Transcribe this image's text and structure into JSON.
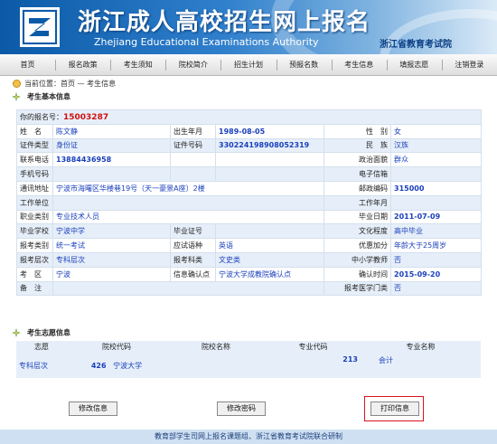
{
  "header": {
    "title": "浙江成人高校招生网上报名",
    "subtitle": "Zhejiang Educational Examinations Authority",
    "authority": "浙江省教育考试院"
  },
  "nav": [
    "首页",
    "报名政策",
    "考生须知",
    "院校简介",
    "招生计划",
    "预报名数",
    "考生信息",
    "填报志愿",
    "注销登录"
  ],
  "breadcrumb": "当前位置：首页 — 考生信息",
  "basic": {
    "section_title": "考生基本信息",
    "reg_label": "你的报名号：",
    "reg_no": "15003287",
    "name_label": "姓　名",
    "name": "陈文静",
    "birth_label": "出生年月",
    "birth": "1989-08-05",
    "gender_label": "性　别",
    "gender": "女",
    "id_type_label": "证件类型",
    "id_type": "身份证",
    "id_no_label": "证件号码",
    "id_no": "330224198908052319",
    "ethnic_label": "民　族",
    "ethnic": "汉族",
    "phone_label": "联系电话",
    "phone": "13884436958",
    "political_label": "政治面貌",
    "political": "群众",
    "mobile_label": "手机号码",
    "mobile": "",
    "email_label": "电子信箱",
    "email": "",
    "address_label": "通讯地址",
    "address": "宁波市海曙区华楼巷19号（天一豪景A座）2楼",
    "postcode_label": "邮政编码",
    "postcode": "315000",
    "employer_label": "工作单位",
    "employer": "",
    "work_years_label": "工作年月",
    "work_years": "",
    "job_label": "职业类别",
    "job": "专业技术人员",
    "grad_date_label": "毕业日期",
    "grad_date": "2011-07-09",
    "school_label": "毕业学校",
    "school": "宁波中学",
    "cert_label": "毕业证号",
    "cert": "",
    "edu_label": "文化程度",
    "edu": "高中毕业",
    "apply_type_label": "报考类别",
    "apply_type": "统一考试",
    "lang_label": "应试语种",
    "lang": "英语",
    "bonus_label": "优惠加分",
    "bonus": "年龄大于25周岁",
    "level_label": "报考层次",
    "level": "专科层次",
    "subject_label": "报考科类",
    "subject": "文史类",
    "teacher_label": "中小学教师",
    "teacher": "否",
    "exam_area_label": "考　区",
    "exam_area": "宁波",
    "confirm_site_label": "信息确认点",
    "confirm_site": "宁波大学成教院确认点",
    "confirm_time_label": "确认时间",
    "confirm_time": "2015-09-20",
    "remark_label": "备　注",
    "remark": "",
    "medical_label": "报考医学门类",
    "medical": "否"
  },
  "wish": {
    "section_title": "考生志愿信息",
    "headers": [
      "志愿",
      "院校代码",
      "院校名称",
      "专业代码",
      "专业名称"
    ],
    "row": {
      "wish": "专科层次",
      "college_code": "426",
      "college_name": "宁波大学",
      "major_code": "213",
      "major_name": "会计"
    }
  },
  "buttons": {
    "edit_info": "修改信息",
    "edit_pwd": "修改密码",
    "print": "打印信息"
  },
  "footer": "教育部学生司网上报名课题组、浙江省教育考试院联合研制",
  "colors": {
    "accent": "#1a3fbd",
    "reg_no": "#d01010",
    "highlight": "#d9141b",
    "row_tint": "#e6eff9"
  }
}
